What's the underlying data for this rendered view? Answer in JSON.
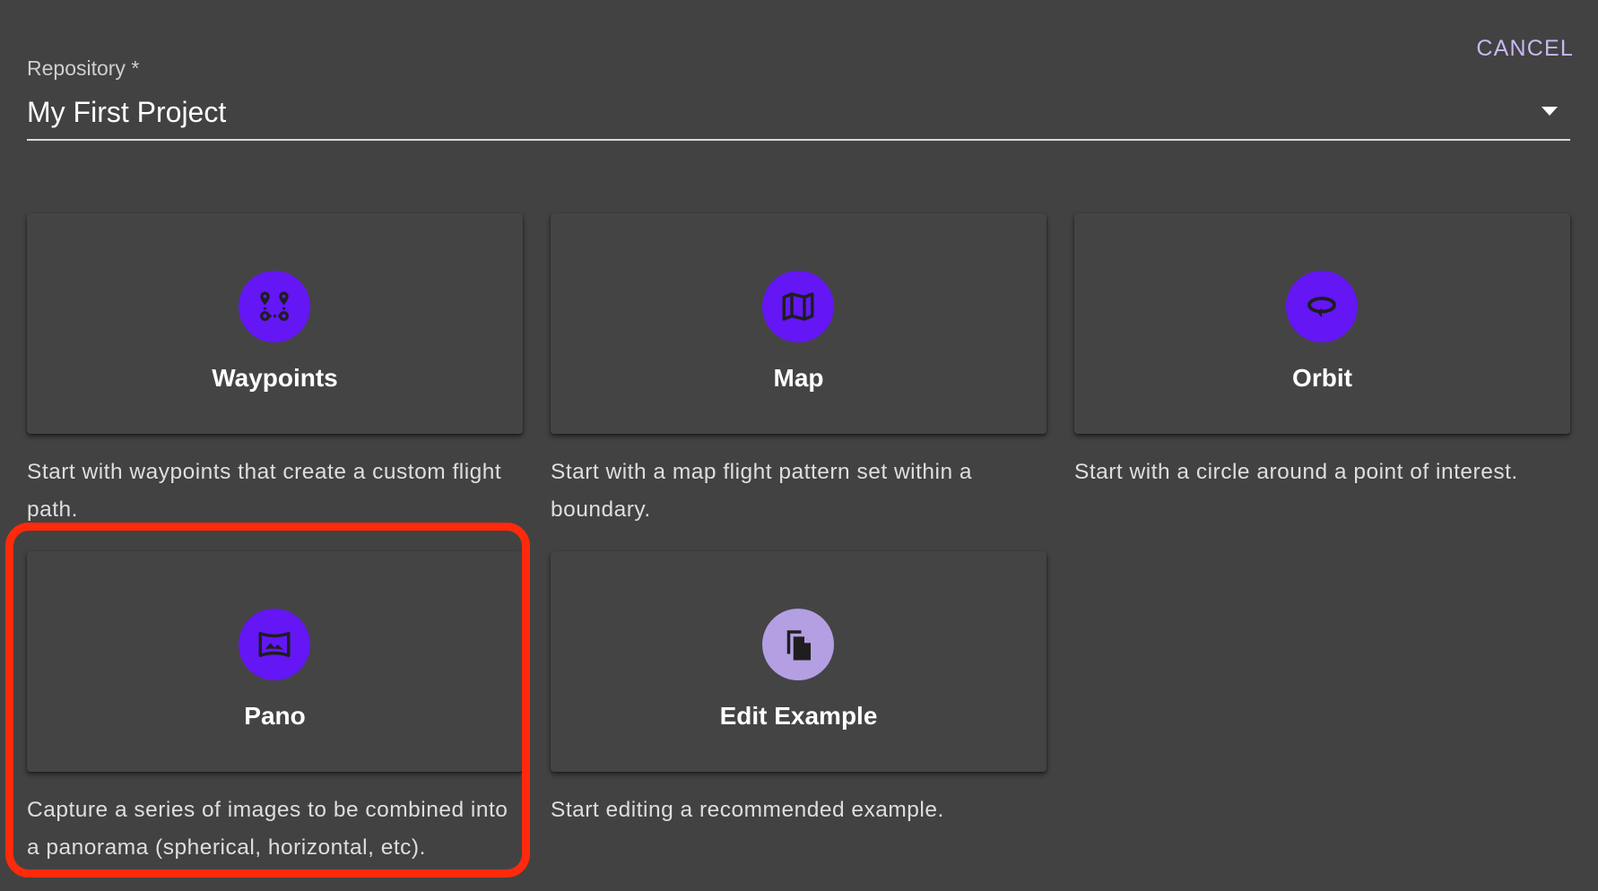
{
  "header": {
    "cancel_label": "CANCEL"
  },
  "repository": {
    "label": "Repository *",
    "value": "My First Project"
  },
  "options": [
    {
      "title": "Waypoints",
      "description": "Start with waypoints that create a custom flight path.",
      "icon": "waypoints-icon"
    },
    {
      "title": "Map",
      "description": "Start with a map flight pattern set within a boundary.",
      "icon": "map-icon"
    },
    {
      "title": "Orbit",
      "description": "Start with a circle around a point of interest.",
      "icon": "orbit-icon"
    },
    {
      "title": "Pano",
      "description": "Capture a series of images to be combined into a panorama (spherical, horizontal, etc).",
      "icon": "panorama-icon"
    },
    {
      "title": "Edit Example",
      "description": "Start editing a recommended example.",
      "icon": "copy-document-icon"
    }
  ],
  "colors": {
    "background": "#424242",
    "card": "#444444",
    "accent": "#6416f5",
    "accent_light": "#b49fe3",
    "cancel": "#c9b8f2",
    "highlight": "#ff2a0c"
  }
}
